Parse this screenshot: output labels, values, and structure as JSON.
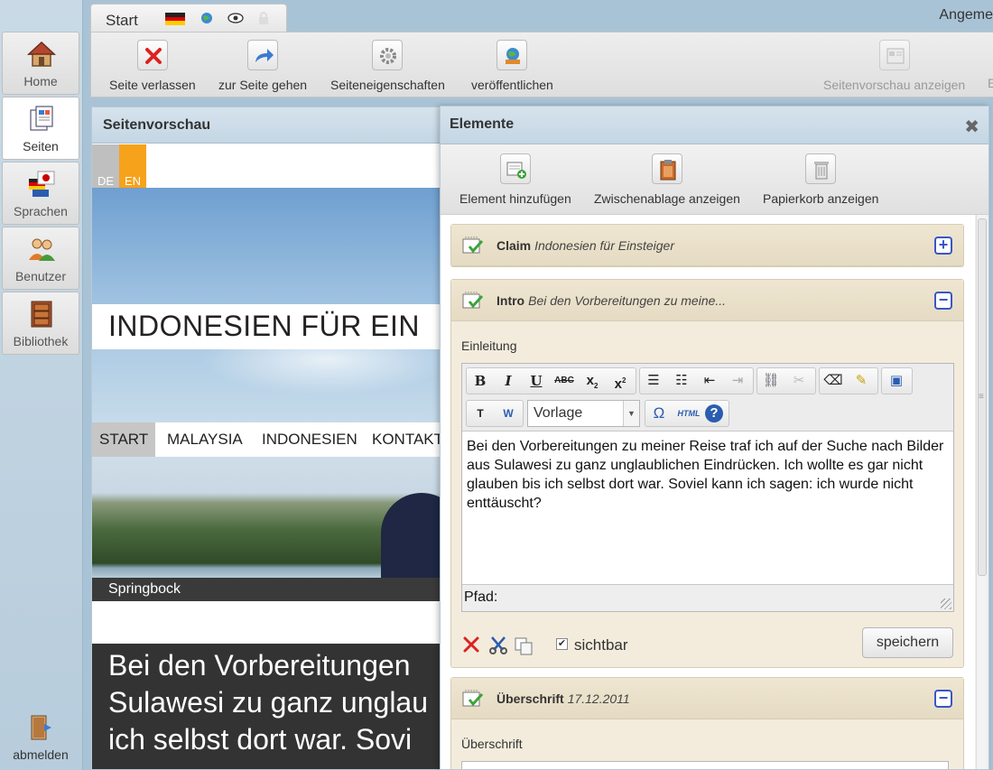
{
  "sidebar": {
    "items": [
      {
        "label": "Home",
        "icon": "house-icon"
      },
      {
        "label": "Seiten",
        "icon": "pages-icon"
      },
      {
        "label": "Sprachen",
        "icon": "flags-icon"
      },
      {
        "label": "Benutzer",
        "icon": "users-icon"
      },
      {
        "label": "Bibliothek",
        "icon": "cabinet-icon"
      }
    ],
    "logout_label": "abmelden"
  },
  "topbar": {
    "tab_label": "Start",
    "right_label": "Angeme",
    "buttons": [
      {
        "label": "Seite verlassen",
        "icon": "close-red-icon"
      },
      {
        "label": "zur Seite gehen",
        "icon": "goto-arrow-icon"
      },
      {
        "label": "Seiteneigenschaften",
        "icon": "gear-icon"
      },
      {
        "label": "veröffentlichen",
        "icon": "publish-globe-icon"
      },
      {
        "label": "Seitenvorschau anzeigen",
        "icon": "preview-icon",
        "disabled": true
      }
    ],
    "trailing_letter": "E"
  },
  "preview": {
    "title": "Seitenvorschau",
    "lang_de": "DE",
    "lang_en": "EN",
    "hero_title": "INDONESIEN FÜR EIN",
    "nav": [
      "START",
      "MALAYSIA",
      "INDONESIEN",
      "KONTAKT"
    ],
    "caption": "Springbock",
    "teaser_lines": [
      "Bei den Vorbereitungen",
      "Sulawesi zu ganz unglau",
      "ich selbst dort war. Sovi"
    ]
  },
  "elements": {
    "title": "Elemente",
    "toolbar": [
      {
        "label": "Element hinzufügen",
        "icon": "add-element-icon"
      },
      {
        "label": "Zwischenablage anzeigen",
        "icon": "clipboard-icon"
      },
      {
        "label": "Papierkorb anzeigen",
        "icon": "trash-icon"
      }
    ],
    "cards": [
      {
        "type": "Claim",
        "subtitle": "Indonesien für Einsteiger",
        "toggle": "+"
      },
      {
        "type": "Intro",
        "subtitle": "Bei den Vorbereitungen zu meine...",
        "toggle": "−"
      },
      {
        "type": "Überschrift",
        "subtitle": "17.12.2011",
        "toggle": "−"
      }
    ],
    "intro": {
      "field_label": "Einleitung",
      "style_select": "Vorlage",
      "content": "Bei den Vorbereitungen zu meiner Reise traf ich auf der Suche nach Bilder aus Sulawesi zu ganz unglaublichen Eindrücken. Ich wollte es gar nicht glauben bis ich selbst dort war. Soviel kann ich sagen: ich wurde nicht enttäuscht?",
      "path_label": "Pfad:",
      "visible_label": "sichtbar",
      "visible_checked": true,
      "save_label": "speichern"
    },
    "ueberschrift": {
      "field_label": "Überschrift"
    }
  },
  "colors": {
    "accent_orange": "#f7a21b",
    "card_bg": "#f3ecdd",
    "panel_header": "#c4d6e4",
    "toggle_blue": "#3856c8"
  }
}
